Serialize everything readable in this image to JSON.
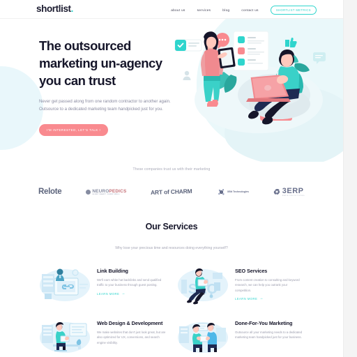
{
  "header": {
    "logo": "shortlist",
    "logo_dot": ".",
    "nav": [
      {
        "label": "about us"
      },
      {
        "label": "services"
      },
      {
        "label": "blog"
      },
      {
        "label": "contact us"
      }
    ],
    "cta_label": "SHORTLIST METRICS"
  },
  "hero": {
    "title_line1": "The outsourced",
    "title_line2": "marketing un-agency",
    "title_line3": "you can trust",
    "subtitle": "Never get passed along from one random contractor to another again. Outsource to a dedicated marketing team handpicked just for you.",
    "cta_label": "I'M INTERESTED, LET'S TALK !"
  },
  "trust": {
    "label": "These companies trust us with their marketing",
    "logos": [
      {
        "name": "Relote"
      },
      {
        "name": "NEUROPEDICS",
        "sub": "SLEEP SMART. SLEEP WELL"
      },
      {
        "name": "ART of CHARM"
      },
      {
        "name": "XBit Technologies"
      },
      {
        "name": "3ERP",
        "sub": "RAPID PROTOTYPING"
      }
    ]
  },
  "services": {
    "title": "Our Services",
    "subtitle": "Why lose your precious time and resources doing everything yourself?",
    "link_label": "LEARN MORE",
    "cards": [
      {
        "title": "Link Building",
        "body": "We'll earn white hat backlinks and send qualified traffic to your business through guest posting.",
        "art": "link-building-illustration"
      },
      {
        "title": "SEO Services",
        "body": "From content creation to consulting and keyword research, we can help you outrank your competition.",
        "art": "seo-illustration"
      },
      {
        "title": "Web Design & Development",
        "body": "We make websites that don't just look great, but are also optimized for UX, conversions, and search engine visibility.",
        "art": "web-design-illustration"
      },
      {
        "title": "Done-For-You Marketing",
        "body": "Outsource all your marketing needs to a dedicated marketing team handpicked just for your business.",
        "art": "done-for-you-illustration"
      }
    ]
  },
  "colors": {
    "accent_teal": "#2fd5cd",
    "accent_coral": "#f98a8f",
    "text_dark": "#16162a",
    "text_muted": "#9b9cad",
    "bg_pale_blue": "#eaf8fa"
  }
}
